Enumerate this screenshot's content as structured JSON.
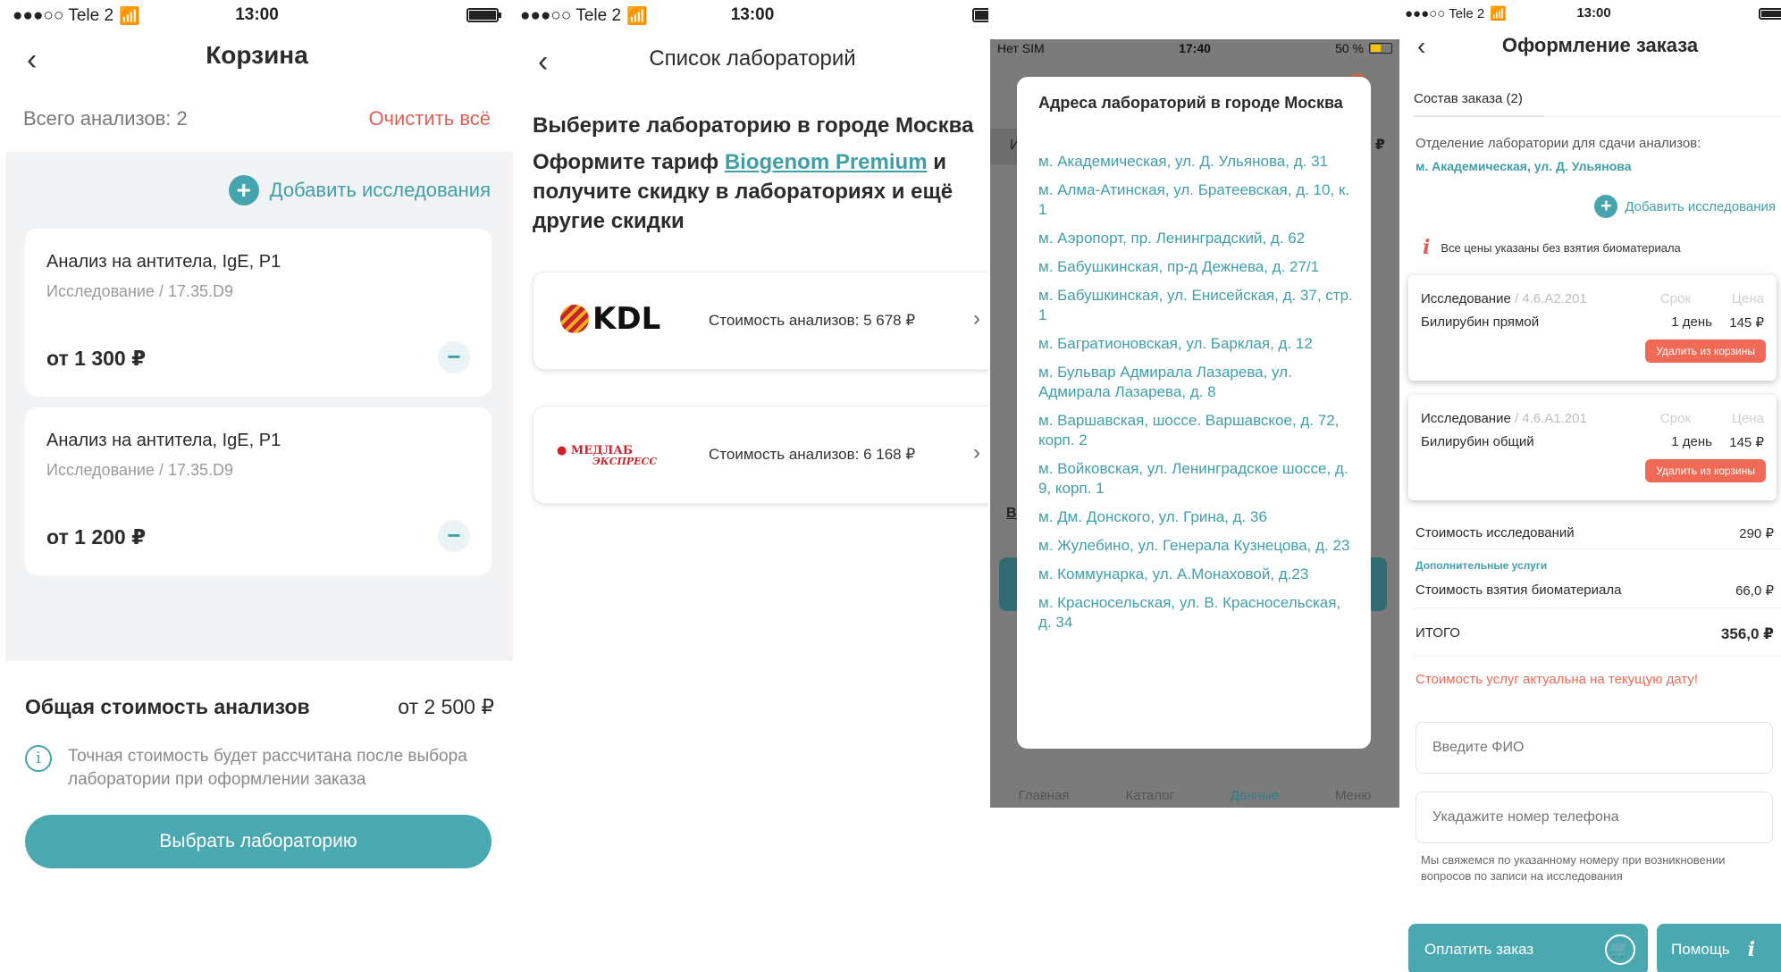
{
  "screen1": {
    "status": {
      "carrier": "●●●○○ Tele 2",
      "time": "13:00"
    },
    "title": "Корзина",
    "total_label": "Всего анализов: 2",
    "clear_label": "Очистить всё",
    "add_label": "Добавить исследования",
    "cards": [
      {
        "name": "Анализ на антитела, IgE, P1",
        "sub": "Исследование  /  17.35.D9",
        "price": "от 1 300 ₽"
      },
      {
        "name": "Анализ на антитела, IgE, P1",
        "sub": "Исследование  /  17.35.D9",
        "price": "от 1 200 ₽"
      }
    ],
    "sum_label": "Общая стоимость анализов",
    "sum_value": "от 2 500 ₽",
    "info_text": "Точная стоимость будет рассчитана после выбора лаборатории при оформлении заказа",
    "select_button": "Выбрать лабораторию"
  },
  "screen2": {
    "status": {
      "carrier": "●●●○○ Tele 2",
      "time": "13:00"
    },
    "title": "Список лабораторий",
    "heading1": "Выберите лабораторию в городе Москва",
    "heading2_pre": "Оформите тариф ",
    "heading2_link": "Biogenom Premium",
    "heading2_post": " и получите скидку в лабораториях и ещё другие скидки",
    "labs": [
      {
        "logo": "KDL",
        "cost": "Стоимость анализов:  5 678 ₽"
      },
      {
        "logo": "МЕДЛАБ",
        "logo_sub": "ЭКСПРЕСС",
        "cost": "Стоимость анализов:  6 168 ₽"
      }
    ]
  },
  "screen3": {
    "status": {
      "carrier": "Нет SIM",
      "time": "17:40",
      "battery": "50 %"
    },
    "modal_title": "Адреса лабораторий в городе Москва",
    "addresses": [
      "м. Академическая, ул. Д. Ульянова, д. 31",
      "м. Алма-Атинская, ул. Братеевская, д. 10, к. 1",
      "м. Аэропорт, пр. Ленинградский, д. 62",
      "м. Бабушкинская, пр-д Дежнева, д. 27/1",
      "м. Бабушкинская, ул. Енисейская, д. 37, стр. 1",
      "м. Багратионовская, ул. Барклая, д. 12",
      "м. Бульвар Адмирала Лазарева, ул. Адмирала Лазарева, д. 8",
      "м. Варшавская, шоссе. Варшавское, д. 72, корп. 2",
      "м. Войковская, ул. Ленинградское шоссе, д. 9, корп. 1",
      "м. Дм. Донского, ул. Грина, д. 36",
      "м. Жулебино, ул. Генерала Кузнецова, д. 23",
      "м. Коммунарка, ул. А.Монаховой, д.23",
      "м. Красносельская, ул. В. Красносельская, д. 34"
    ],
    "tabs": [
      "Главная",
      "Каталог",
      "Данные",
      "Меню"
    ],
    "behind": {
      "l1": "И",
      "l2": "₽",
      "l3": "В"
    }
  },
  "screen4": {
    "status": {
      "carrier": "●●●○○ Tele 2",
      "time": "13:00"
    },
    "title": "Оформление заказа",
    "tab": "Состав заказа (2)",
    "dept_label": "Отделение лаборатории для сдачи анализов:",
    "dept_value": "м. Академическая, ул. Д. Ульянова",
    "add_label": "Добавить исследования",
    "note": "Все цены указаны без взятия биоматериала",
    "items": [
      {
        "label": "Исследование",
        "code": " / 4.6.A2.201",
        "h_term": "Срок",
        "h_price": "Цена",
        "name": "Билирубин прямой",
        "term": "1 день",
        "price": "145 ₽",
        "delete": "Удалить из корзины"
      },
      {
        "label": "Исследование",
        "code": " / 4.6.A1.201",
        "h_term": "Срок",
        "h_price": "Цена",
        "name": "Билирубин общий",
        "term": "1 день",
        "price": "145 ₽",
        "delete": "Удалить из корзины"
      }
    ],
    "cost_label": "Стоимость исследований",
    "cost_value": "290 ₽",
    "extra_label": "Дополнительные услуги",
    "bio_label": "Стоимость взятия биоматериала",
    "bio_value": "66,0 ₽",
    "total_label": "ИТОГО",
    "total_value": "356,0 ₽",
    "actual_note": "Стоимость услуг актуальна на текущую дату!",
    "name_placeholder": "Введите ФИО",
    "phone_placeholder": "Укадажите номер телефона",
    "hint": "Мы свяжемся по указанному номеру при возникновении вопросов по записи на исследования",
    "pay_button": "Оплатить заказ",
    "help_button": "Помощь"
  }
}
